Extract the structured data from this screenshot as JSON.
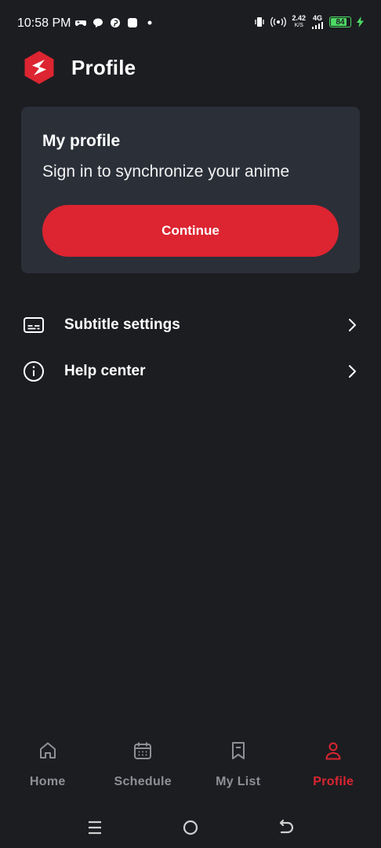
{
  "status_bar": {
    "time": "10:58 PM",
    "speed_value": "2.42",
    "speed_unit": "K/S",
    "network": "4G",
    "battery_level": "84",
    "battery_fraction": 0.84,
    "left_icons": [
      "gamepad-icon",
      "chat-bubble-icon",
      "pinterest-icon",
      "app-square-icon",
      "dot-icon"
    ],
    "right_icons": [
      "vibrate-icon",
      "hotspot-icon",
      "signal-icon",
      "battery-icon",
      "charging-icon"
    ]
  },
  "header": {
    "logo_icon": "app-logo-icon",
    "title": "Profile"
  },
  "profile_card": {
    "title": "My profile",
    "subtitle": "Sign in to synchronize your anime",
    "continue_label": "Continue"
  },
  "menu": {
    "items": [
      {
        "label": "Subtitle settings",
        "icon": "subtitles-icon"
      },
      {
        "label": "Help center",
        "icon": "info-icon"
      }
    ]
  },
  "bottom_nav": {
    "items": [
      {
        "label": "Home",
        "icon": "home-icon",
        "active": false
      },
      {
        "label": "Schedule",
        "icon": "calendar-icon",
        "active": false
      },
      {
        "label": "My List",
        "icon": "bookmark-icon",
        "active": false
      },
      {
        "label": "Profile",
        "icon": "person-icon",
        "active": true
      }
    ]
  },
  "colors": {
    "background": "#1c1d21",
    "card": "#2b2f38",
    "accent": "#dc2531",
    "inactive": "#8f9095",
    "battery": "#4cd964"
  }
}
